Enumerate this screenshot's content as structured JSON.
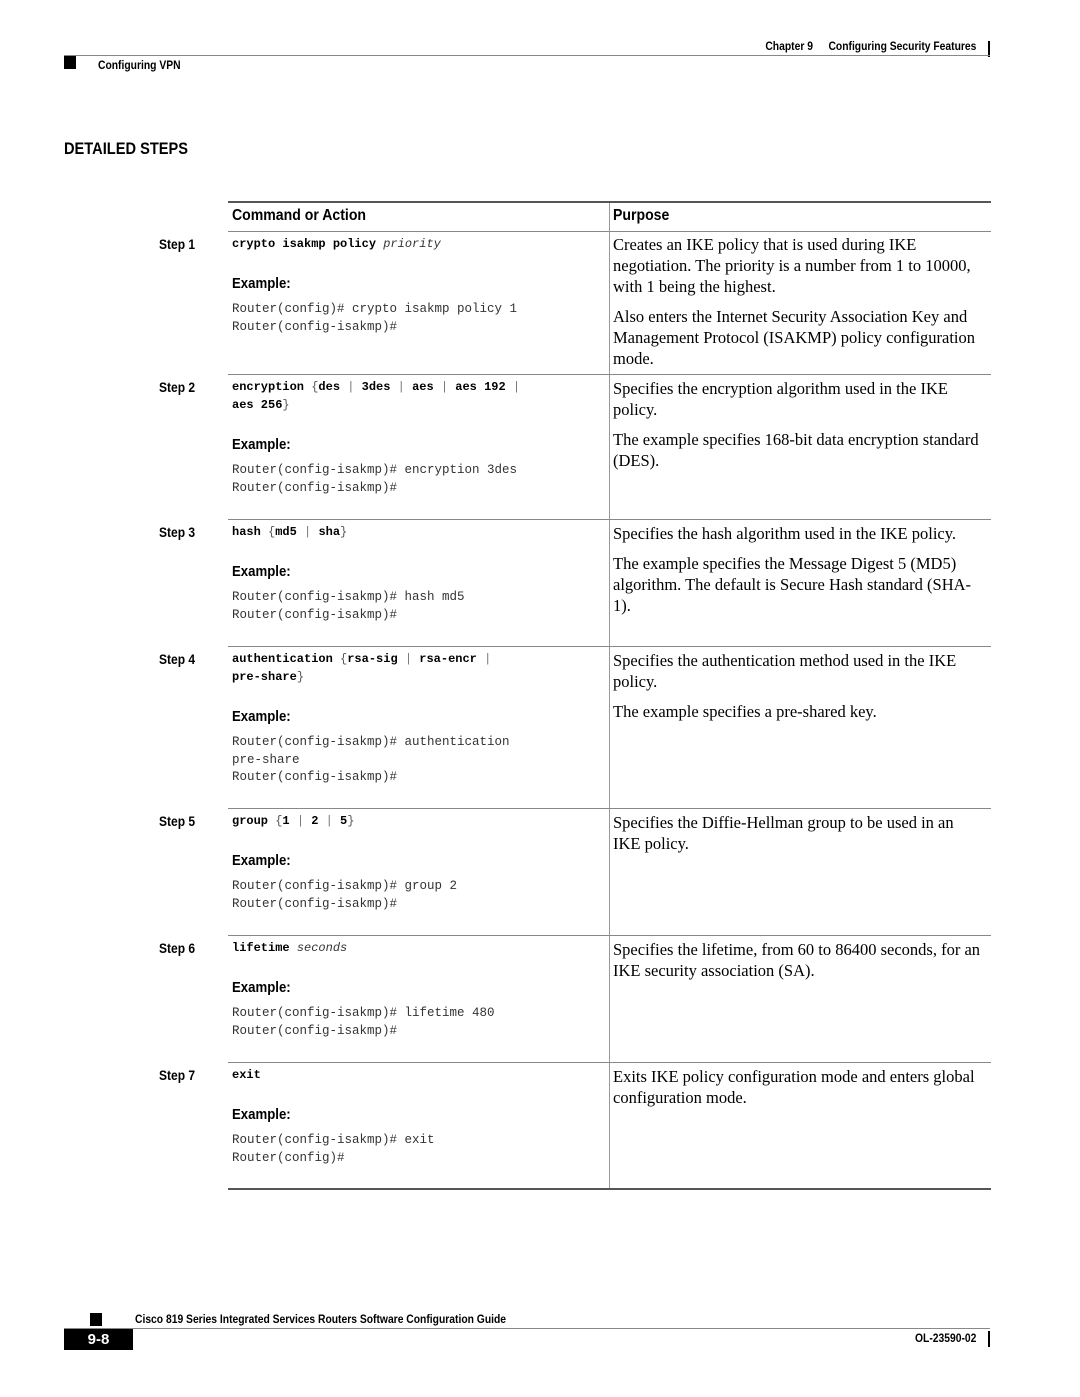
{
  "header": {
    "chapter_label": "Chapter 9",
    "chapter_title": "Configuring Security Features",
    "section": "Configuring VPN"
  },
  "section_title": "DETAILED STEPS",
  "table": {
    "columns": [
      "Command or Action",
      "Purpose"
    ],
    "example_label": "Example:",
    "steps": [
      {
        "label": "Step 1",
        "example": [
          "Router(config)# crypto isakmp policy 1",
          "Router(config-isakmp)#"
        ],
        "purpose": [
          "Creates an IKE policy that is used during IKE negotiation. The priority is a number from 1 to 10000, with 1 being the highest.",
          "Also enters the Internet Security Association Key and Management Protocol (ISAKMP) policy configuration mode."
        ]
      },
      {
        "label": "Step 2",
        "example": [
          "Router(config-isakmp)# encryption 3des",
          "Router(config-isakmp)#"
        ],
        "purpose": [
          "Specifies the encryption algorithm used in the IKE policy.",
          "The example specifies 168-bit data encryption standard (DES)."
        ]
      },
      {
        "label": "Step 3",
        "example": [
          "Router(config-isakmp)# hash md5",
          "Router(config-isakmp)#"
        ],
        "purpose": [
          "Specifies the hash algorithm used in the IKE policy.",
          "The example specifies the Message Digest 5 (MD5) algorithm. The default is Secure Hash standard (SHA-1)."
        ]
      },
      {
        "label": "Step 4",
        "example": [
          "Router(config-isakmp)# authentication",
          "pre-share",
          "Router(config-isakmp)#"
        ],
        "purpose": [
          "Specifies the authentication method used in the IKE policy.",
          "The example specifies a pre-shared key."
        ]
      },
      {
        "label": "Step 5",
        "example": [
          "Router(config-isakmp)# group 2",
          "Router(config-isakmp)#"
        ],
        "purpose": [
          "Specifies the Diffie-Hellman group to be used in an IKE policy."
        ]
      },
      {
        "label": "Step 6",
        "example": [
          "Router(config-isakmp)# lifetime 480",
          "Router(config-isakmp)#"
        ],
        "purpose": [
          "Specifies the lifetime, from 60 to 86400 seconds, for an IKE security association (SA)."
        ]
      },
      {
        "label": "Step 7",
        "example": [
          "Router(config-isakmp)# exit",
          "Router(config)#"
        ],
        "purpose": [
          "Exits IKE policy configuration mode and enters global configuration mode."
        ]
      }
    ],
    "syntax": {
      "s1": {
        "cmd": "crypto isakmp policy",
        "arg": "priority"
      },
      "s2": {
        "cmd": "encryption",
        "opts": [
          "des",
          "3des",
          "aes",
          "aes 192",
          "aes 256"
        ]
      },
      "s3": {
        "cmd": "hash",
        "opts": [
          "md5",
          "sha"
        ]
      },
      "s4": {
        "cmd": "authentication",
        "opts": [
          "rsa-sig",
          "rsa-encr",
          "pre-share"
        ]
      },
      "s5": {
        "cmd": "group",
        "opts": [
          "1",
          "2",
          "5"
        ]
      },
      "s6": {
        "cmd": "lifetime",
        "arg": "seconds"
      },
      "s7": {
        "cmd": "exit"
      }
    }
  },
  "footer": {
    "guide_title": "Cisco 819 Series Integrated Services Routers Software Configuration Guide",
    "page_number": "9-8",
    "doc_id": "OL-23590-02"
  }
}
